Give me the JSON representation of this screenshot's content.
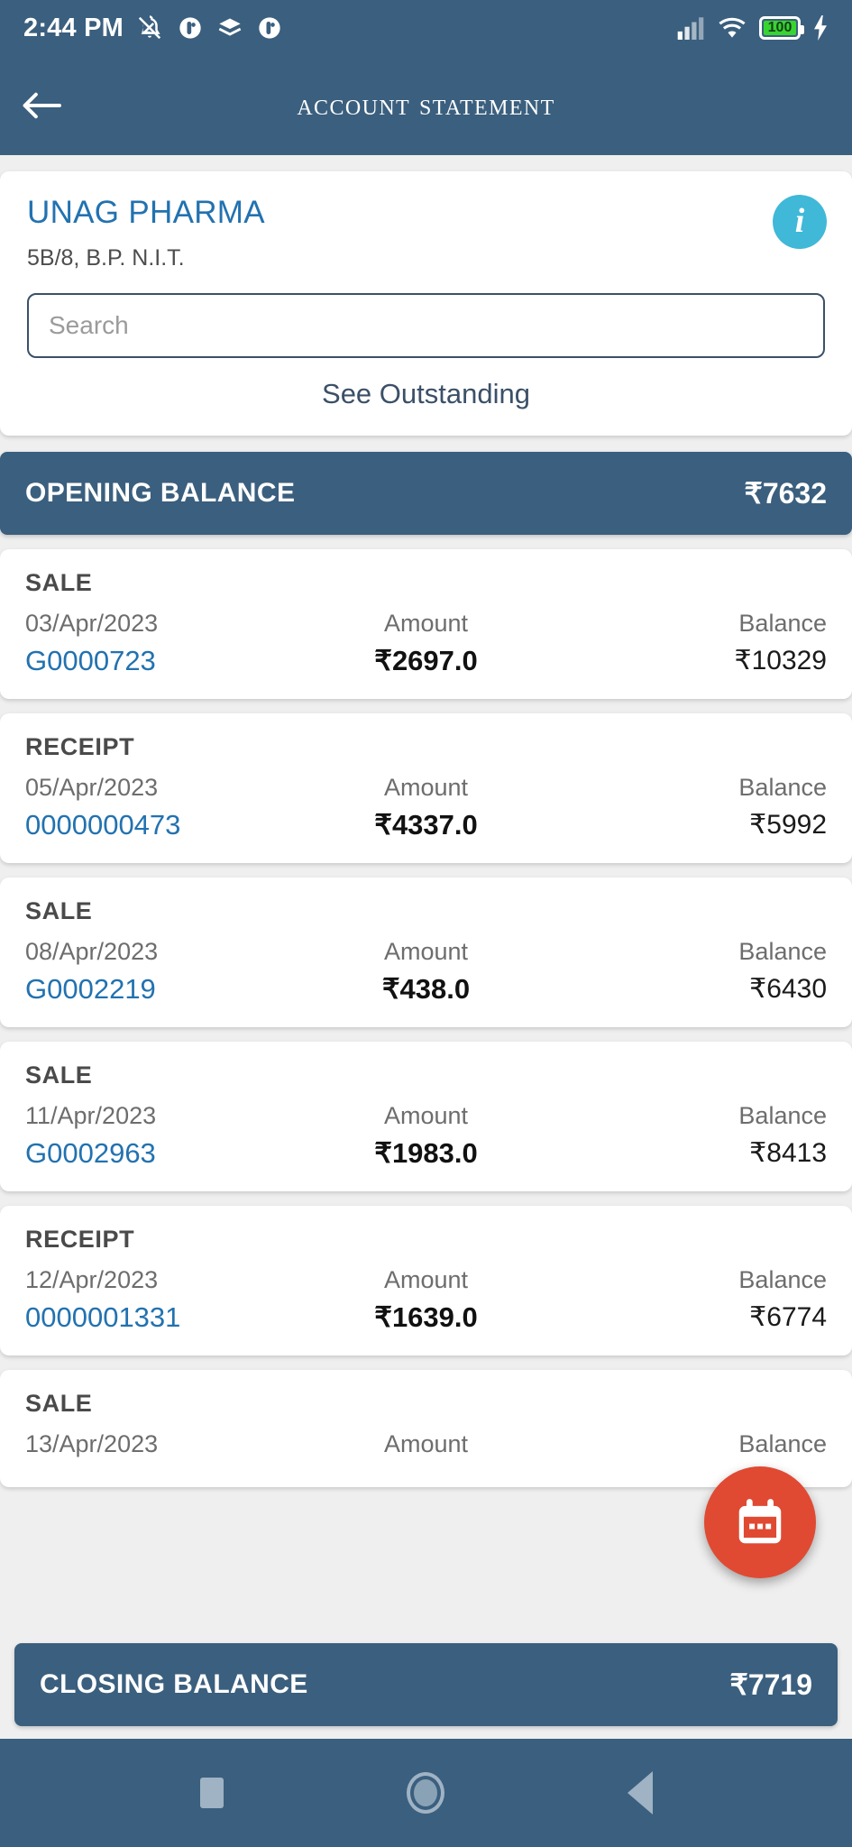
{
  "statusbar": {
    "time": "2:44 PM",
    "battery_level": "100",
    "icons": [
      "bell-off-icon",
      "app-circle-icon",
      "layers-icon",
      "app-circle-icon-2",
      "signal-icon",
      "wifi-icon",
      "battery-icon",
      "charging-bolt-icon"
    ]
  },
  "appbar": {
    "title": "Account Statement",
    "back_icon": "arrow-left-icon"
  },
  "party": {
    "name": "UNAG PHARMA",
    "address": "5B/8, B.P. N.I.T.",
    "info_icon": "info-icon",
    "info_glyph": "i"
  },
  "search": {
    "placeholder": "Search",
    "value": ""
  },
  "actions": {
    "see_outstanding": "See Outstanding"
  },
  "opening": {
    "label": "OPENING BALANCE",
    "value": "₹7632"
  },
  "closing": {
    "label": "CLOSING BALANCE",
    "value": "₹7719"
  },
  "column_labels": {
    "amount": "Amount",
    "balance": "Balance"
  },
  "fab": {
    "icon": "calendar-icon",
    "color": "#e04a32"
  },
  "navbar": {
    "recent_icon": "square-recents-icon",
    "home_icon": "circle-home-icon",
    "back_icon": "triangle-back-icon"
  },
  "colors": {
    "primary": "#3b5f7e",
    "link": "#2272b0",
    "info": "#40b8d8",
    "fab": "#e04a32",
    "page_bg": "#efefef"
  },
  "transactions": [
    {
      "type": "SALE",
      "date": "03/Apr/2023",
      "id": "G0000723",
      "amount": "₹2697.0",
      "balance": "₹10329"
    },
    {
      "type": "RECEIPT",
      "date": "05/Apr/2023",
      "id": "0000000473",
      "amount": "₹4337.0",
      "balance": "₹5992"
    },
    {
      "type": "SALE",
      "date": "08/Apr/2023",
      "id": "G0002219",
      "amount": "₹438.0",
      "balance": "₹6430"
    },
    {
      "type": "SALE",
      "date": "11/Apr/2023",
      "id": "G0002963",
      "amount": "₹1983.0",
      "balance": "₹8413"
    },
    {
      "type": "RECEIPT",
      "date": "12/Apr/2023",
      "id": "0000001331",
      "amount": "₹1639.0",
      "balance": "₹6774"
    },
    {
      "type": "SALE",
      "date": "13/Apr/2023",
      "id": "",
      "amount": "",
      "balance": ""
    }
  ]
}
